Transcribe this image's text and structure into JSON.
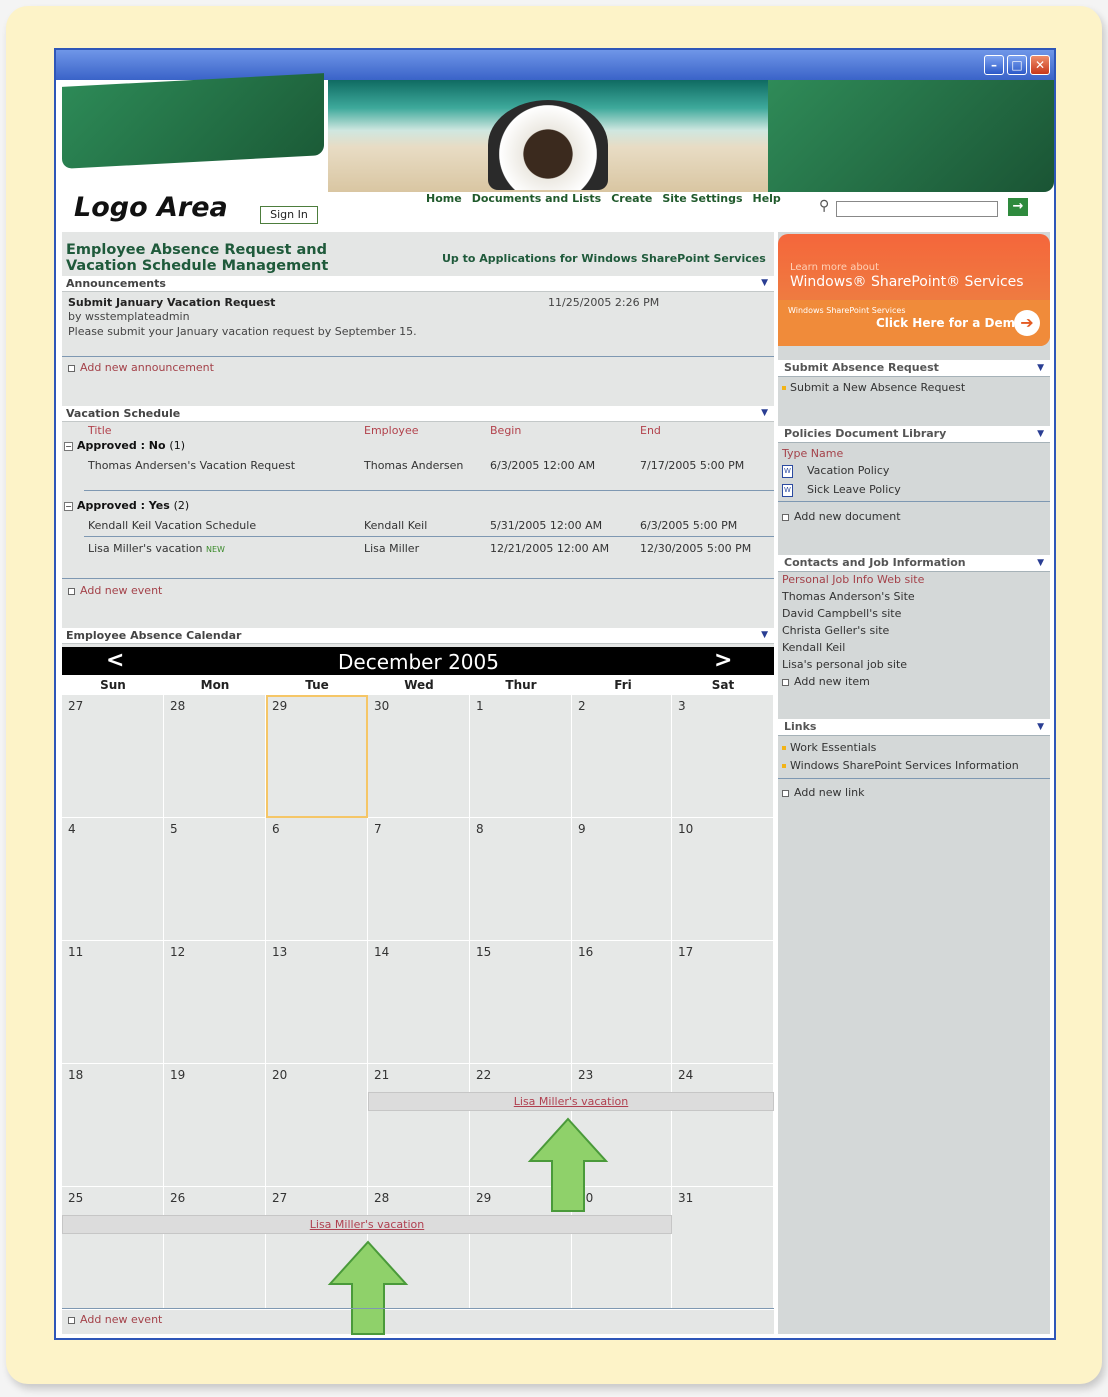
{
  "window": {
    "minimize": "–",
    "maximize": "□",
    "close": "✕"
  },
  "header": {
    "logo": "Logo Area",
    "sign_in": "Sign In",
    "nav": [
      "Home",
      "Documents and Lists",
      "Create",
      "Site Settings",
      "Help"
    ],
    "search": {
      "placeholder": "",
      "value": "",
      "go_label": "→"
    }
  },
  "site": {
    "title_line1": "Employee Absence Request and",
    "title_line2": "Vacation Schedule Management",
    "up_link": "Up to Applications for Windows SharePoint Services"
  },
  "announcements": {
    "title": "Announcements",
    "item_title": "Submit January Vacation Request",
    "item_date": "11/25/2005 2:26 PM",
    "item_by": "by wsstemplateadmin",
    "item_body": "Please submit your January vacation request by September 15.",
    "add_link": "Add new announcement"
  },
  "vacation": {
    "title": "Vacation Schedule",
    "columns": [
      "Title",
      "Employee",
      "Begin",
      "End"
    ],
    "group_no": {
      "label": "Approved : No",
      "count": "(1)"
    },
    "group_yes": {
      "label": "Approved : Yes",
      "count": "(2)"
    },
    "rows_no": [
      [
        "Thomas Andersen's Vacation Request",
        "Thomas Andersen",
        "6/3/2005 12:00 AM",
        "7/17/2005 5:00 PM"
      ]
    ],
    "rows_yes": [
      [
        "Kendall Keil Vacation Schedule",
        "Kendall Keil",
        "5/31/2005 12:00 AM",
        "6/3/2005 5:00 PM"
      ],
      [
        "Lisa Miller's vacation",
        "Lisa Miller",
        "12/21/2005 12:00 AM",
        "12/30/2005 5:00 PM"
      ]
    ],
    "new_badge": "NEW",
    "add_link": "Add new event"
  },
  "calendar": {
    "title": "Employee Absence Calendar",
    "prev": "<",
    "next": ">",
    "month": "December 2005",
    "days": [
      "Sun",
      "Mon",
      "Tue",
      "Wed",
      "Thur",
      "Fri",
      "Sat"
    ],
    "weeks": [
      [
        "27",
        "28",
        "29",
        "30",
        "1",
        "2",
        "3"
      ],
      [
        "4",
        "5",
        "6",
        "7",
        "8",
        "9",
        "10"
      ],
      [
        "11",
        "12",
        "13",
        "14",
        "15",
        "16",
        "17"
      ],
      [
        "18",
        "19",
        "20",
        "21",
        "22",
        "23",
        "24"
      ],
      [
        "25",
        "26",
        "27",
        "28",
        "29",
        "30",
        "31"
      ]
    ],
    "event1": "Lisa Miller's vacation",
    "event2": "Lisa Miller's vacation",
    "add_link": "Add new event",
    "arrow_color": "#8fd16a"
  },
  "sidebar": {
    "promo": {
      "learn": "Learn more about",
      "product": "Windows® SharePoint® Services",
      "windows": "Windows SharePoint Services",
      "demo": "Click Here for a Demo"
    },
    "absence": {
      "title": "Submit Absence Request",
      "item": "Submit a New Absence Request"
    },
    "policies": {
      "title": "Policies Document Library",
      "col_type": "Type",
      "col_name": "Name",
      "docs": [
        "Vacation Policy",
        "Sick Leave Policy"
      ],
      "add_link": "Add new document"
    },
    "contacts": {
      "title": "Contacts and Job Information",
      "items": [
        "Personal Job Info Web site",
        "Thomas Anderson's Site",
        "David Campbell's site",
        "Christa Geller's site",
        "Kendall Keil",
        "Lisa's personal job site"
      ],
      "add_link": "Add new item"
    },
    "links": {
      "title": "Links",
      "items": [
        "Work Essentials",
        "Windows SharePoint Services Information"
      ],
      "add_link": "Add new link"
    }
  },
  "colors": {
    "accent_green": "#1f5a3b",
    "link_red": "#a4424a",
    "window_blue": "#2e56b8",
    "frame_cream": "#fdf3c8"
  }
}
